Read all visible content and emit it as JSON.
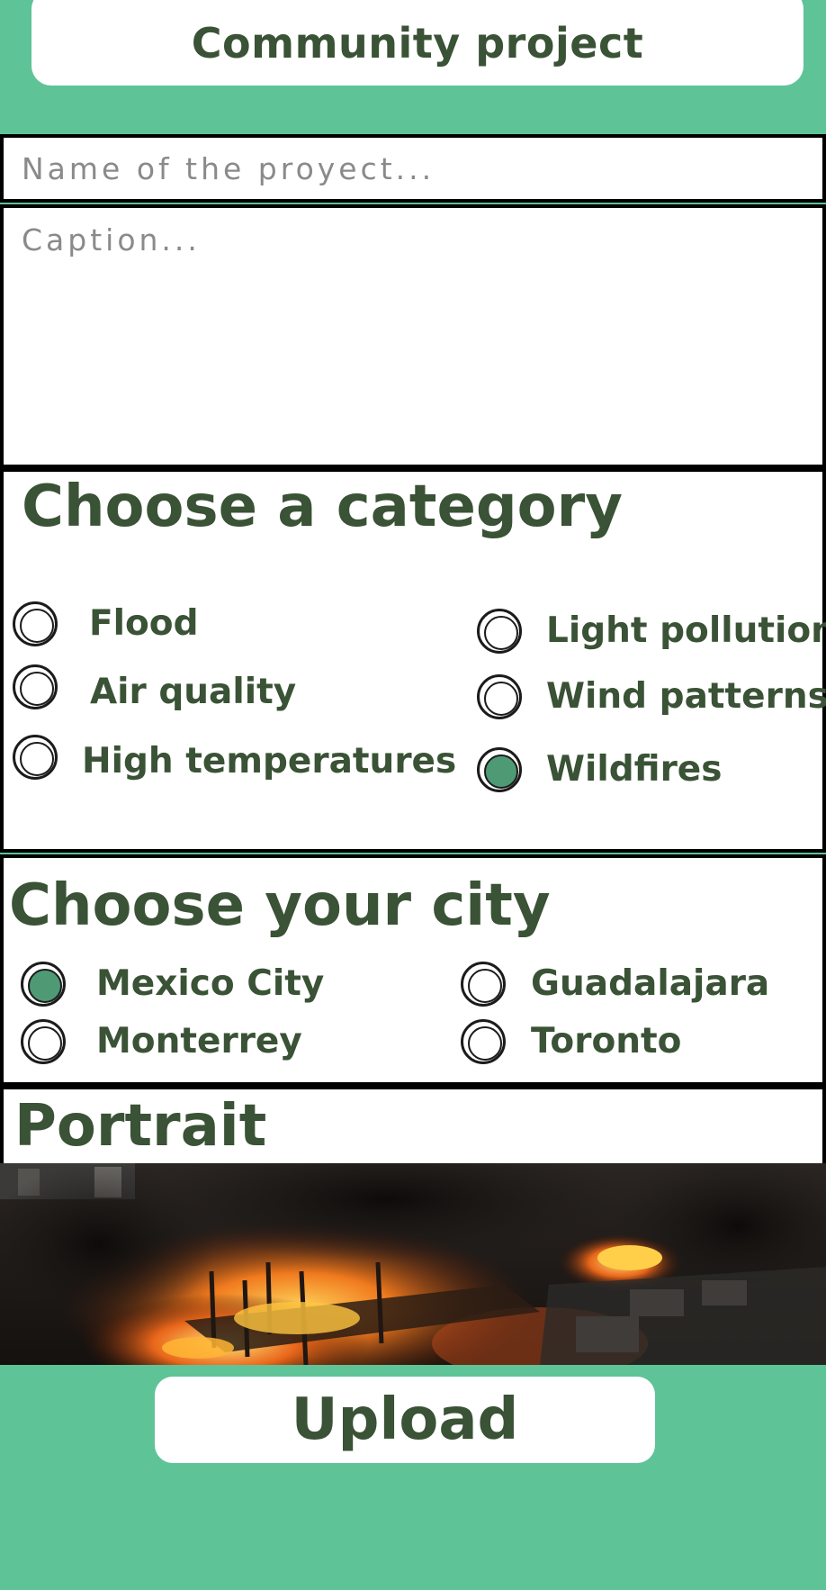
{
  "header": {
    "title": "Community project"
  },
  "form": {
    "name_placeholder": "Name of the proyect...",
    "caption_placeholder": "Caption..."
  },
  "category": {
    "title": "Choose a category",
    "options": [
      {
        "label": "Flood",
        "checked": false
      },
      {
        "label": "Air quality",
        "checked": false
      },
      {
        "label": "High temperatures",
        "checked": false
      },
      {
        "label": "Light pollution",
        "checked": false
      },
      {
        "label": "Wind patterns",
        "checked": false
      },
      {
        "label": "Wildfires",
        "checked": true
      }
    ]
  },
  "city": {
    "title": "Choose your city",
    "options": [
      {
        "label": "Mexico City",
        "checked": true
      },
      {
        "label": "Monterrey",
        "checked": false
      },
      {
        "label": "Guadalajara",
        "checked": false
      },
      {
        "label": "Toronto",
        "checked": false
      }
    ]
  },
  "portrait": {
    "title": "Portrait"
  },
  "upload": {
    "label": "Upload"
  },
  "colors": {
    "background": "#5fc398",
    "text": "#3a5235",
    "selected": "#4e9a74"
  }
}
